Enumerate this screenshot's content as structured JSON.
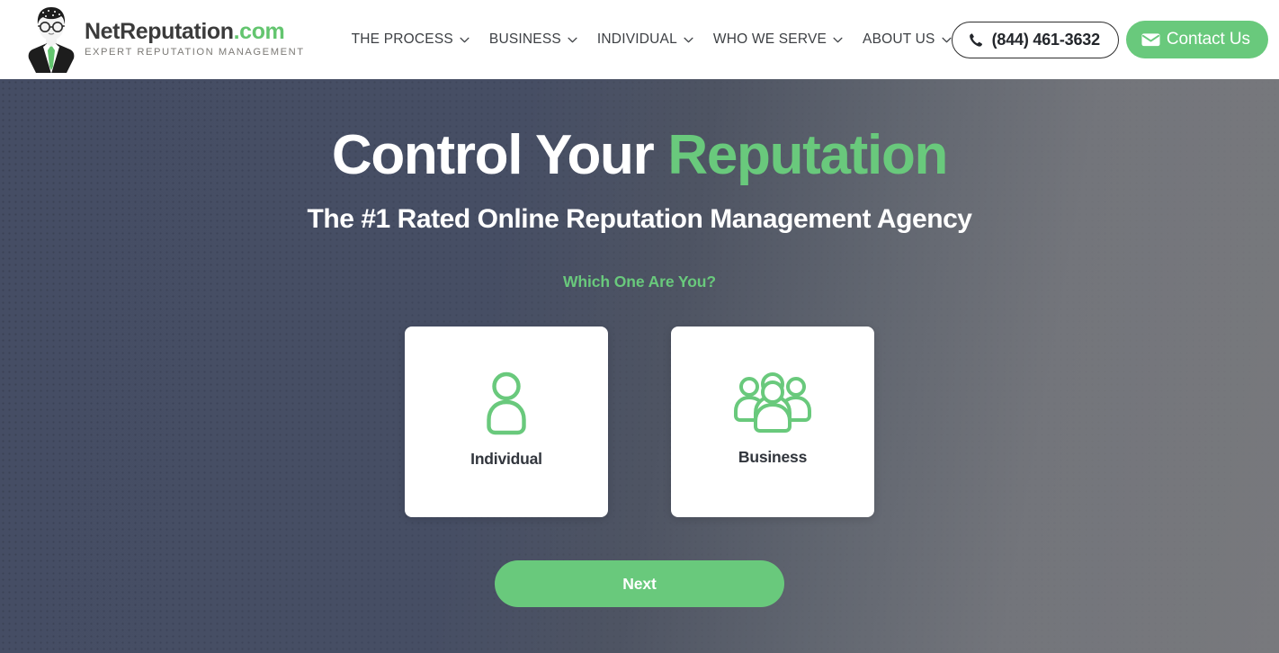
{
  "header": {
    "logo": {
      "icon": "person-with-glasses-logo-icon",
      "name_primary": "NetReputation",
      "name_suffix": ".com",
      "tagline": "EXPERT REPUTATION MANAGEMENT"
    },
    "nav": [
      {
        "label": "THE PROCESS",
        "icon": "chevron-down-icon"
      },
      {
        "label": "BUSINESS",
        "icon": "chevron-down-icon"
      },
      {
        "label": "INDIVIDUAL",
        "icon": "chevron-down-icon"
      },
      {
        "label": "WHO WE SERVE",
        "icon": "chevron-down-icon"
      },
      {
        "label": "ABOUT US",
        "icon": "chevron-down-icon"
      }
    ],
    "phone": {
      "label": "(844) 461-3632",
      "icon": "phone-icon"
    },
    "contact": {
      "label": "Contact Us",
      "icon": "envelope-icon"
    }
  },
  "hero": {
    "headline_part1": "Control Your ",
    "headline_accent": "Reputation",
    "subheadline": "The #1 Rated Online Reputation Management Agency",
    "question": "Which One Are You?",
    "choices": [
      {
        "label": "Individual",
        "icon": "single-person-icon"
      },
      {
        "label": "Business",
        "icon": "group-of-people-icon"
      }
    ],
    "next_label": "Next"
  },
  "colors": {
    "green": "#69c97c",
    "hero_dark": "#454d64",
    "hero_light": "#78797d",
    "nav_text": "#3c3f43",
    "card_label": "#32363d"
  }
}
